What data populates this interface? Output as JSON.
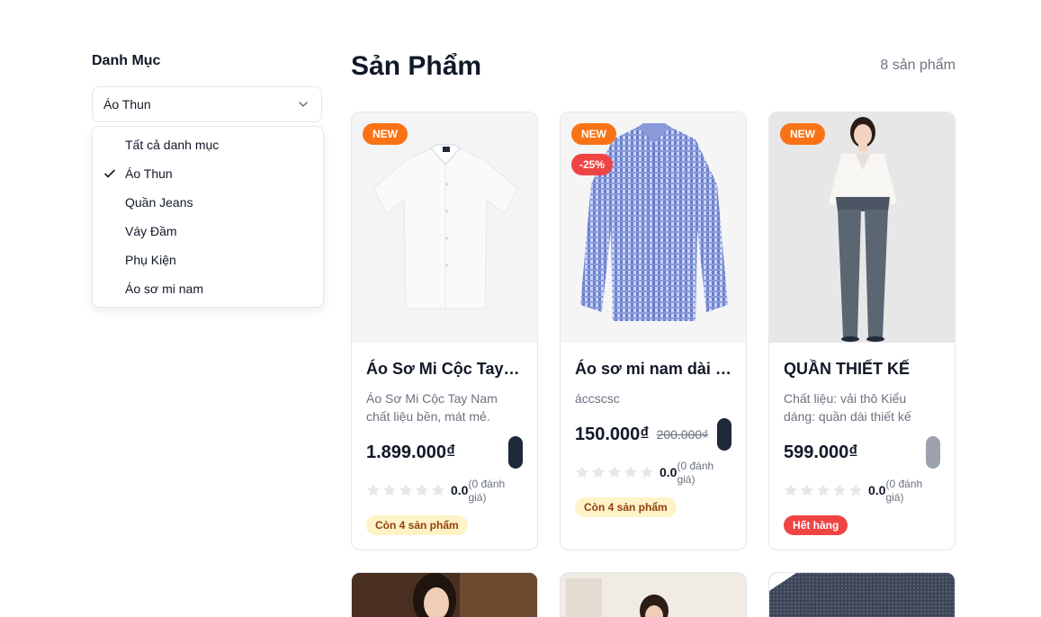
{
  "sidebar": {
    "title": "Danh Mục",
    "selected": "Áo Thun",
    "options": [
      "Tất cả danh mục",
      "Áo Thun",
      "Quần Jeans",
      "Váy Đầm",
      "Phụ Kiện",
      "Áo sơ mi nam"
    ]
  },
  "main": {
    "title": "Sản Phẩm",
    "count": "8 sản phẩm"
  },
  "products": [
    {
      "badge_new": "NEW",
      "name": "Áo Sơ Mi Cộc Tay Nam",
      "desc": "Áo Sơ Mi Cộc Tay Nam chất liệu bền, mát mẻ.",
      "price": "1.899.000₫",
      "rating": "0.0",
      "rating_count": "(0 đánh giá)",
      "stock": "Còn 4 sản phẩm"
    },
    {
      "badge_new": "NEW",
      "badge_sale": "-25%",
      "name": "Áo sơ mi nam dài tay",
      "desc": "áccscsc",
      "price": "150.000₫",
      "old_price": "200.000₫",
      "rating": "0.0",
      "rating_count": "(0 đánh giá)",
      "stock": "Còn 4 sản phẩm"
    },
    {
      "badge_new": "NEW",
      "name": "QUẦN THIẾT KẾ",
      "desc": "Chất liệu: vải thô Kiểu dáng: quần dài thiết kế",
      "price": "599.000₫",
      "rating": "0.0",
      "rating_count": "(0 đánh giá)",
      "stock": "Hết hàng"
    }
  ],
  "colors": {
    "accent_new": "#f97316",
    "accent_sale": "#ef4444",
    "stock_bg": "#fef3c7",
    "out_of_stock": "#ef4444"
  }
}
